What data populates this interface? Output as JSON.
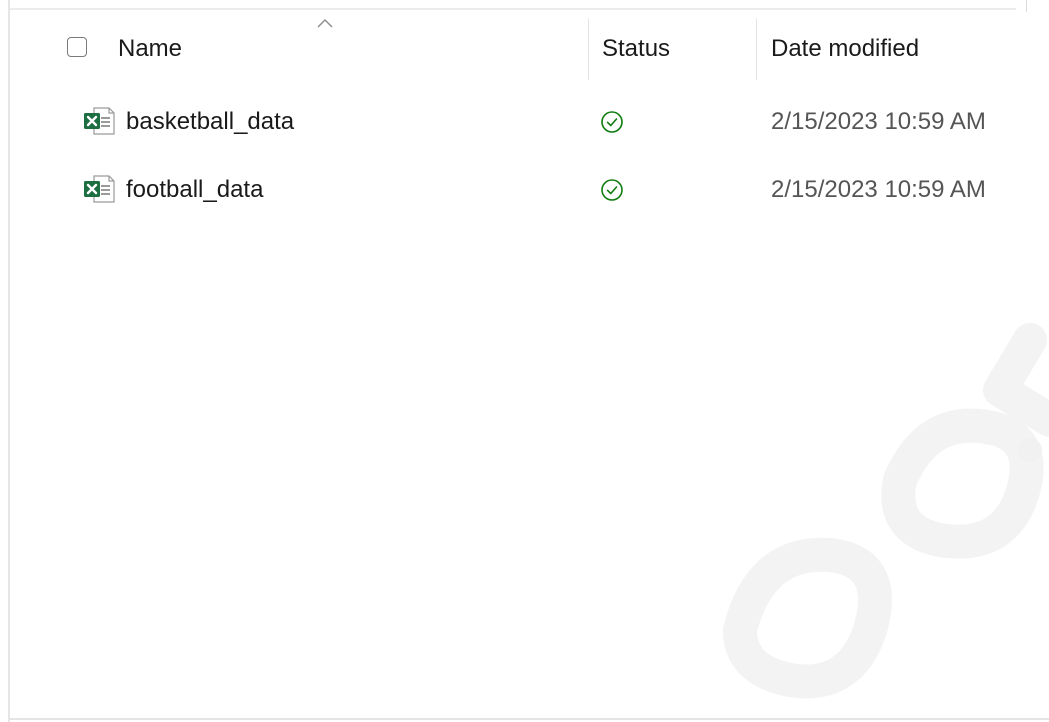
{
  "header": {
    "name_label": "Name",
    "status_label": "Status",
    "date_label": "Date modified"
  },
  "files": [
    {
      "name": "basketball_data",
      "type_icon": "excel-file-icon",
      "status_icon": "available-check-icon",
      "date_modified": "2/15/2023 10:59 AM"
    },
    {
      "name": "football_data",
      "type_icon": "excel-file-icon",
      "status_icon": "available-check-icon",
      "date_modified": "2/15/2023 10:59 AM"
    }
  ],
  "colors": {
    "excel_green": "#1d6f42",
    "status_green": "#107c10",
    "text": "#1a1a1a",
    "date_text": "#555555"
  }
}
